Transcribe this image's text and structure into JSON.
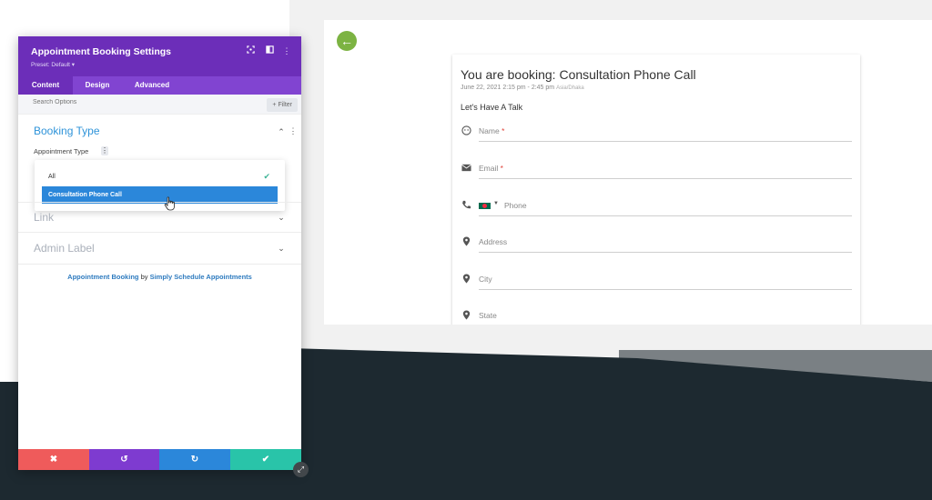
{
  "colors": {
    "panel_header": "#6c2eb9",
    "tabs_bg": "#8144d1",
    "accent_blue": "#2e93d9",
    "dark_band": "#1d2930",
    "green": "#7cb342",
    "btn_cancel": "#ef5b5b",
    "btn_undo": "#7e3bd0",
    "btn_redo": "#2b87da",
    "btn_save": "#29c4a9"
  },
  "panel": {
    "title": "Appointment Booking Settings",
    "preset": "Preset: Default ▾",
    "header_icons": [
      "focus-icon",
      "layout-icon",
      "more-icon"
    ],
    "tabs": [
      {
        "label": "Content",
        "active": true
      },
      {
        "label": "Design",
        "active": false
      },
      {
        "label": "Advanced",
        "active": false
      }
    ],
    "search_placeholder": "Search Options",
    "filter_label": "+ Filter",
    "sections": {
      "booking_type": "Booking Type",
      "appointment_type_label": "Appointment Type",
      "link": "Link",
      "admin_label": "Admin Label"
    },
    "dropdown": {
      "options": [
        "All",
        "Consultation Phone Call"
      ],
      "selected": "Consultation Phone Call"
    },
    "credit": {
      "prefix": "Appointment Booking",
      "by": " by ",
      "suffix": "Simply Schedule Appointments"
    },
    "actions": [
      "close-icon",
      "undo-icon",
      "redo-icon",
      "check-icon"
    ]
  },
  "preview": {
    "title": "You are booking: Consultation Phone Call",
    "date": "June 22, 2021 2:15 pm - 2:45 pm",
    "timezone": "Asia/Dhaka",
    "subtitle": "Let's Have A Talk",
    "fields": [
      {
        "label": "Name",
        "required": true,
        "icon": "face-icon"
      },
      {
        "label": "Email",
        "required": true,
        "icon": "email-icon"
      },
      {
        "label": "Phone",
        "required": false,
        "icon": "phone-icon"
      },
      {
        "label": "Address",
        "required": false,
        "icon": "location-icon"
      },
      {
        "label": "City",
        "required": false,
        "icon": "location-icon"
      },
      {
        "label": "State",
        "required": false,
        "icon": "location-icon"
      }
    ],
    "required_mark": "*",
    "back_icon": "arrow-left-icon"
  }
}
